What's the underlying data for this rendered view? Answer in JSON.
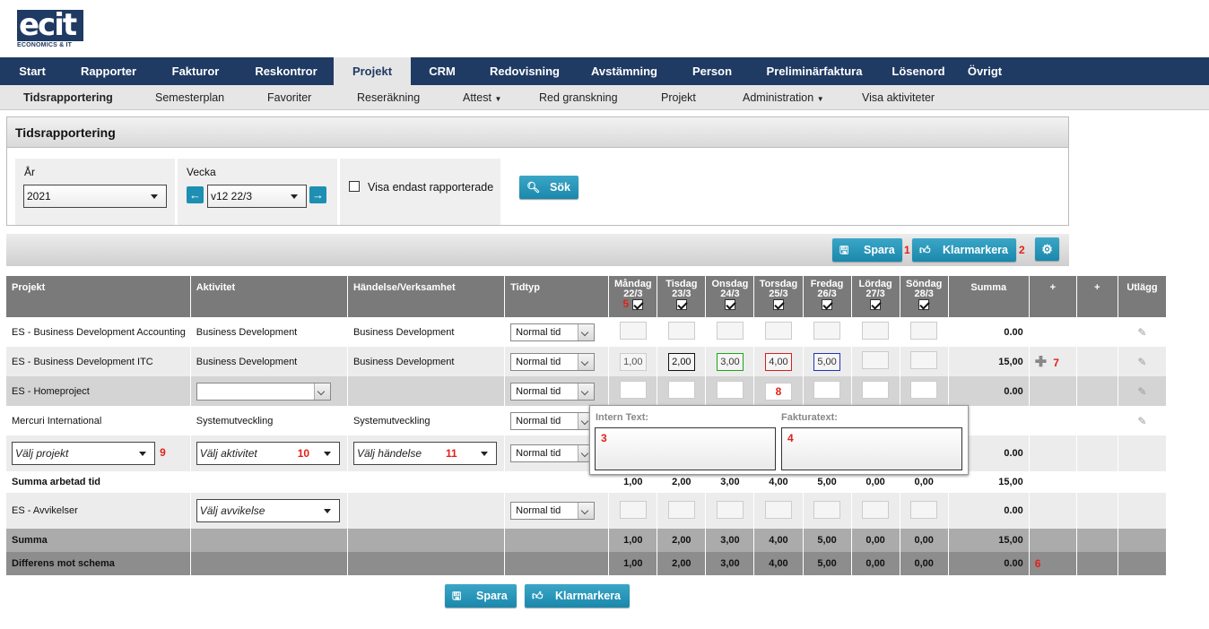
{
  "logo": {
    "main": "ecit",
    "sub": "ECONOMICS & IT"
  },
  "topnav": [
    "Start",
    "Rapporter",
    "Fakturor",
    "Reskontror",
    "Projekt",
    "CRM",
    "Redovisning",
    "Avstämning",
    "Person",
    "Preliminärfaktura",
    "Lösenord",
    "Övrigt"
  ],
  "subnav": [
    "Tidsrapportering",
    "Semesterplan",
    "Favoriter",
    "Reseräkning",
    "Attest",
    "Red granskning",
    "Projekt",
    "Administration",
    "Visa aktiviteter"
  ],
  "panel": {
    "title": "Tidsrapportering",
    "year_label": "År",
    "year_value": "2021",
    "week_label": "Vecka",
    "week_value": "v12 22/3",
    "only_reported": "Visa endast rapporterade",
    "search": "Sök"
  },
  "actions": {
    "save": "Spara",
    "mark_ready": "Klarmarkera"
  },
  "columns": {
    "project": "Projekt",
    "activity": "Aktivitet",
    "event": "Händelse/Verksamhet",
    "timetype": "Tidtyp",
    "sum": "Summa",
    "plus1": "+",
    "plus2": "+",
    "expense": "Utlägg"
  },
  "days": [
    {
      "name": "Måndag",
      "date": "22/3"
    },
    {
      "name": "Tisdag",
      "date": "23/3"
    },
    {
      "name": "Onsdag",
      "date": "24/3"
    },
    {
      "name": "Torsdag",
      "date": "25/3"
    },
    {
      "name": "Fredag",
      "date": "26/3"
    },
    {
      "name": "Lördag",
      "date": "27/3"
    },
    {
      "name": "Söndag",
      "date": "28/3"
    }
  ],
  "rows": [
    {
      "project": "ES - Business Development Accounting",
      "activity": "Business Development",
      "event": "Business Development",
      "timetype": "Normal tid",
      "hours": [
        "",
        "",
        "",
        "",
        "",
        "",
        ""
      ],
      "sum": "0.00"
    },
    {
      "project": "ES - Business Development ITC",
      "activity": "Business Development",
      "event": "Business Development",
      "timetype": "Normal tid",
      "hours": [
        "1,00",
        "2,00",
        "3,00",
        "4,00",
        "5,00",
        "",
        ""
      ],
      "sum": "15,00"
    },
    {
      "project": "ES - Homeproject",
      "activity": "",
      "event": "",
      "timetype": "Normal tid",
      "hours": [
        "",
        "",
        "",
        "",
        "",
        "",
        ""
      ],
      "sum": "0.00"
    },
    {
      "project": "Mercuri International",
      "activity": "Systemutveckling",
      "event": "Systemutveckling",
      "timetype": "Normal tid",
      "hours": [
        "",
        "",
        "",
        "",
        "",
        "",
        ""
      ],
      "sum": ""
    },
    {
      "project": "Välj projekt",
      "activity": "Välj aktivitet",
      "event": "Välj händelse",
      "timetype": "Normal tid",
      "hours": [
        "",
        "",
        "",
        "",
        "",
        "",
        ""
      ],
      "sum": "0.00"
    }
  ],
  "summa_arbetad": {
    "label": "Summa arbetad tid",
    "values": [
      "1,00",
      "2,00",
      "3,00",
      "4,00",
      "5,00",
      "0,00",
      "0,00"
    ],
    "sum": "15,00"
  },
  "avvikelse": {
    "project": "ES - Avvikelser",
    "activity": "Välj avvikelse",
    "timetype": "Normal tid",
    "sum": "0.00"
  },
  "summa": {
    "label": "Summa",
    "values": [
      "1,00",
      "2,00",
      "3,00",
      "4,00",
      "5,00",
      "0,00",
      "0,00"
    ],
    "sum": "15,00"
  },
  "differens": {
    "label": "Differens mot schema",
    "values": [
      "1,00",
      "2,00",
      "3,00",
      "4,00",
      "5,00",
      "0,00",
      "0,00"
    ],
    "sum": "0.00"
  },
  "popup": {
    "intern": "Intern Text:",
    "faktura": "Fakturatext:"
  },
  "markers": [
    "1",
    "2",
    "3",
    "4",
    "5",
    "6",
    "7",
    "8",
    "9",
    "10",
    "11"
  ],
  "colors": {
    "nav": "#1f3a63",
    "button": "#1a88ad",
    "marker": "#e0211b"
  }
}
